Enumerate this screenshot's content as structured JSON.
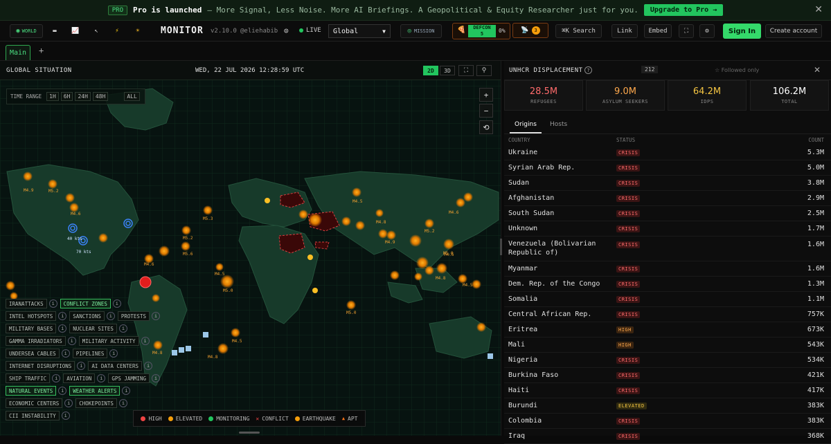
{
  "banner": {
    "badge": "PRO",
    "title": "Pro is launched",
    "text": "– More Signal, Less Noise. More AI Briefings. A Geopolitical & Equity Researcher just for you.",
    "cta": "Upgrade to Pro →",
    "close": "✕"
  },
  "topbar": {
    "world": "WORLD",
    "brand": "MONITOR",
    "version": "v2.10.0",
    "handle": "@eliehabib",
    "live": "LIVE",
    "region": "Global",
    "mission": "MISSION",
    "defcon": "DEFCON",
    "defcon_level": "5",
    "defcon_pct": "0%",
    "alerts": "3",
    "search": "⌘K Search",
    "link": "Link",
    "embed": "Embed",
    "signin": "Sign In",
    "create": "Create account"
  },
  "tabs": {
    "main": "Main",
    "add": "+"
  },
  "map": {
    "title": "GLOBAL SITUATION",
    "datetime": "WED, 22 JUL 2026 12:28:59 UTC",
    "mode2d": "2D",
    "mode3d": "3D",
    "time_range": "TIME RANGE",
    "ranges": [
      "1H",
      "6H",
      "24H",
      "48H",
      "ALL"
    ],
    "labels": [
      "M4.9",
      "M5.2",
      "M4.6",
      "M5.3",
      "M4.5",
      "M4.8",
      "M5.2",
      "M5.6",
      "M4.6",
      "M5.0",
      "M4.5",
      "M5.0",
      "M4.5",
      "M4.6",
      "M4.9",
      "M5.2",
      "M4.8",
      "M4.6",
      "M4.5",
      "M5.0",
      "M4.8",
      "M4.8",
      "40 kts",
      "70 kts"
    ],
    "layers": [
      {
        "row": 0,
        "items": [
          {
            "label": "IRANATTACKS",
            "on": false
          },
          {
            "label": "CONFLICT ZONES",
            "on": true
          }
        ]
      },
      {
        "row": 1,
        "items": [
          {
            "label": "INTEL HOTSPOTS",
            "on": false
          },
          {
            "label": "SANCTIONS",
            "on": false
          },
          {
            "label": "PROTESTS",
            "on": false
          }
        ]
      },
      {
        "row": 2,
        "items": [
          {
            "label": "MILITARY BASES",
            "on": false
          },
          {
            "label": "NUCLEAR SITES",
            "on": false
          }
        ]
      },
      {
        "row": 3,
        "items": [
          {
            "label": "GAMMA IRRADIATORS",
            "on": false
          },
          {
            "label": "MILITARY ACTIVITY",
            "on": false
          }
        ]
      },
      {
        "row": 4,
        "items": [
          {
            "label": "UNDERSEA CABLES",
            "on": false
          },
          {
            "label": "PIPELINES",
            "on": false
          }
        ]
      },
      {
        "row": 5,
        "items": [
          {
            "label": "INTERNET DISRUPTIONS",
            "on": false
          },
          {
            "label": "AI DATA CENTERS",
            "on": false
          }
        ]
      },
      {
        "row": 6,
        "items": [
          {
            "label": "SHIP TRAFFIC",
            "on": false
          },
          {
            "label": "AVIATION",
            "on": false
          },
          {
            "label": "GPS JAMMING",
            "on": false
          }
        ]
      },
      {
        "row": 7,
        "items": [
          {
            "label": "NATURAL EVENTS",
            "on": true
          },
          {
            "label": "WEATHER ALERTS",
            "on": true
          }
        ]
      },
      {
        "row": 8,
        "items": [
          {
            "label": "ECONOMIC CENTERS",
            "on": false
          },
          {
            "label": "CHOKEPOINTS",
            "on": false
          }
        ]
      },
      {
        "row": 9,
        "items": [
          {
            "label": "CII INSTABILITY",
            "on": false
          }
        ]
      }
    ],
    "legend": [
      {
        "label": "HIGH",
        "color": "#ef4444",
        "shape": "dot"
      },
      {
        "label": "ELEVATED",
        "color": "#f59e0b",
        "shape": "dot"
      },
      {
        "label": "MONITORING",
        "color": "#22c55e",
        "shape": "dot"
      },
      {
        "label": "CONFLICT",
        "color": "#ef4444",
        "shape": "x"
      },
      {
        "label": "EARTHQUAKE",
        "color": "#f59e0b",
        "shape": "dot"
      },
      {
        "label": "APT",
        "color": "#f97316",
        "shape": "tri"
      }
    ]
  },
  "panel": {
    "title": "UNHCR DISPLACEMENT",
    "info": "?",
    "count": "212",
    "followed": "☆ Followed only",
    "close": "✕",
    "stats": [
      {
        "value": "28.5M",
        "label": "REFUGEES",
        "color": "#ff6b6b"
      },
      {
        "value": "9.0M",
        "label": "ASYLUM SEEKERS",
        "color": "#ffa94d"
      },
      {
        "value": "64.2M",
        "label": "IDPS",
        "color": "#f5c542"
      },
      {
        "value": "106.2M",
        "label": "TOTAL",
        "color": "#ffffff"
      }
    ],
    "tabs": [
      "Origins",
      "Hosts"
    ],
    "headers": {
      "country": "COUNTRY",
      "status": "STATUS",
      "count": "COUNT"
    },
    "rows": [
      {
        "country": "Ukraine",
        "status": "CRISIS",
        "count": "5.3M"
      },
      {
        "country": "Syrian Arab Rep.",
        "status": "CRISIS",
        "count": "5.0M"
      },
      {
        "country": "Sudan",
        "status": "CRISIS",
        "count": "3.8M"
      },
      {
        "country": "Afghanistan",
        "status": "CRISIS",
        "count": "2.9M"
      },
      {
        "country": "South Sudan",
        "status": "CRISIS",
        "count": "2.5M"
      },
      {
        "country": "Unknown",
        "status": "CRISIS",
        "count": "1.7M"
      },
      {
        "country": "Venezuela (Bolivarian Republic of)",
        "status": "CRISIS",
        "count": "1.6M"
      },
      {
        "country": "Myanmar",
        "status": "CRISIS",
        "count": "1.6M"
      },
      {
        "country": "Dem. Rep. of the Congo",
        "status": "CRISIS",
        "count": "1.3M"
      },
      {
        "country": "Somalia",
        "status": "CRISIS",
        "count": "1.1M"
      },
      {
        "country": "Central African Rep.",
        "status": "CRISIS",
        "count": "757K"
      },
      {
        "country": "Eritrea",
        "status": "HIGH",
        "count": "673K"
      },
      {
        "country": "Mali",
        "status": "HIGH",
        "count": "543K"
      },
      {
        "country": "Nigeria",
        "status": "CRISIS",
        "count": "534K"
      },
      {
        "country": "Burkina Faso",
        "status": "CRISIS",
        "count": "421K"
      },
      {
        "country": "Haiti",
        "status": "CRISIS",
        "count": "417K"
      },
      {
        "country": "Burundi",
        "status": "ELEVATED",
        "count": "383K"
      },
      {
        "country": "Colombia",
        "status": "CRISIS",
        "count": "383K"
      },
      {
        "country": "Iraq",
        "status": "CRISIS",
        "count": "368K"
      }
    ]
  }
}
